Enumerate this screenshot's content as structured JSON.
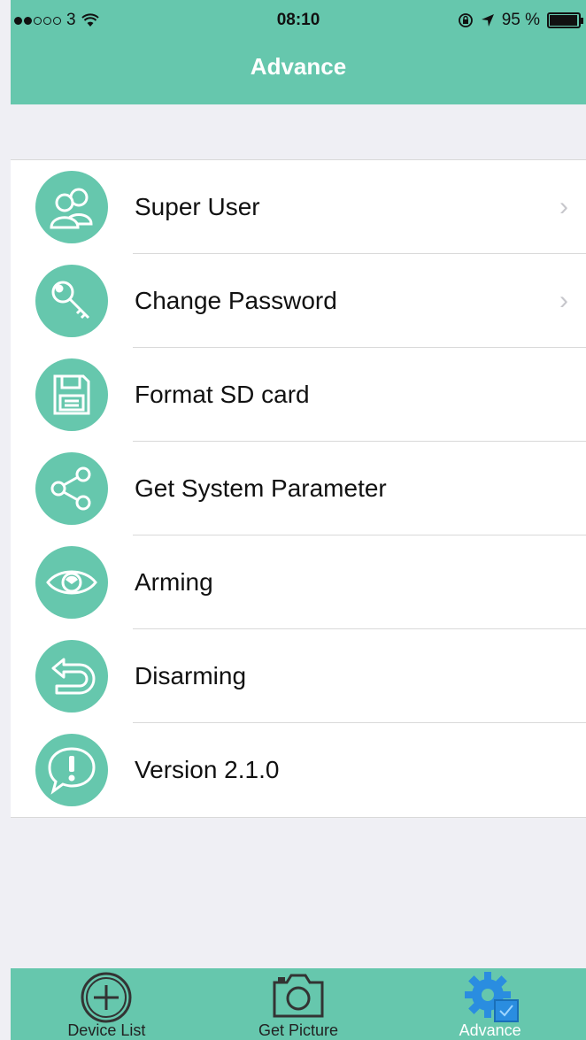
{
  "status_bar": {
    "carrier": "3",
    "time": "08:10",
    "battery": "95 %"
  },
  "nav": {
    "title": "Advance"
  },
  "menu": {
    "items": [
      {
        "label": "Super User",
        "icon": "users-icon",
        "chevron": true
      },
      {
        "label": "Change Password",
        "icon": "key-icon",
        "chevron": true
      },
      {
        "label": "Format SD card",
        "icon": "floppy-disk-icon",
        "chevron": false
      },
      {
        "label": "Get System Parameter",
        "icon": "share-icon",
        "chevron": false
      },
      {
        "label": "Arming",
        "icon": "eye-icon",
        "chevron": false
      },
      {
        "label": "Disarming",
        "icon": "return-arrow-icon",
        "chevron": false
      },
      {
        "label": "Version 2.1.0",
        "icon": "info-bubble-icon",
        "chevron": false
      }
    ]
  },
  "tabbar": {
    "tabs": [
      {
        "label": "Device List",
        "icon": "plus-circle-icon",
        "active": false
      },
      {
        "label": "Get Picture",
        "icon": "camera-icon",
        "active": false
      },
      {
        "label": "Advance",
        "icon": "gear-icon",
        "active": true
      }
    ]
  },
  "colors": {
    "accent": "#66c7ad",
    "background": "#efeff4",
    "active_tab_icon": "#2a8de0"
  }
}
